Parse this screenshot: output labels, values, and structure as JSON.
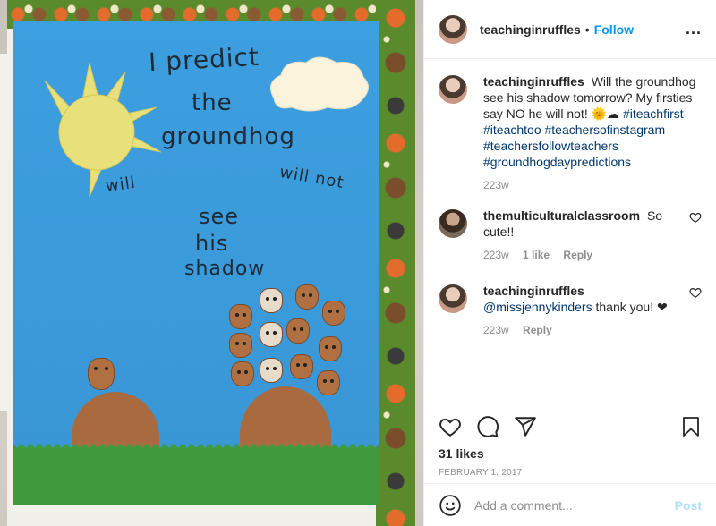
{
  "photo": {
    "text_predict": "I predict",
    "text_the": "the",
    "text_groundhog": "groundhog",
    "text_will": "will",
    "text_will_not": "will not",
    "text_see": "see",
    "text_his": "his",
    "text_shadow": "shadow"
  },
  "header": {
    "username": "teachinginruffles",
    "separator": "•",
    "follow_label": "Follow",
    "more_label": "..."
  },
  "caption": {
    "username": "teachinginruffles",
    "text": "Will the groundhog see his shadow tomorrow? My firsties say NO he will not!",
    "emoji": "🌞☁",
    "hashtags": "#iteachfirst #iteachtoo #teachersofinstagram #teachersfollowteachers #groundhogdaypredictions",
    "time": "223w"
  },
  "comments": [
    {
      "username": "themulticulturalclassroom",
      "text": "So cute!!",
      "time": "223w",
      "likes": "1 like",
      "reply": "Reply"
    },
    {
      "username": "teachinginruffles",
      "mention": "@missjennykinders",
      "text": "thank you! ❤",
      "time": "223w",
      "reply": "Reply"
    }
  ],
  "actions": {
    "likes": "31 likes",
    "date": "FEBRUARY 1, 2017"
  },
  "add_comment": {
    "placeholder": "Add a comment...",
    "post_label": "Post"
  },
  "icons": [
    "heart-icon",
    "comment-icon",
    "share-icon",
    "bookmark-icon",
    "emoji-icon",
    "more-icon"
  ],
  "colors": {
    "link": "#0095f6",
    "hashtag": "#00376b",
    "muted": "#8e8e8e",
    "post_disabled": "#b2dffc"
  }
}
